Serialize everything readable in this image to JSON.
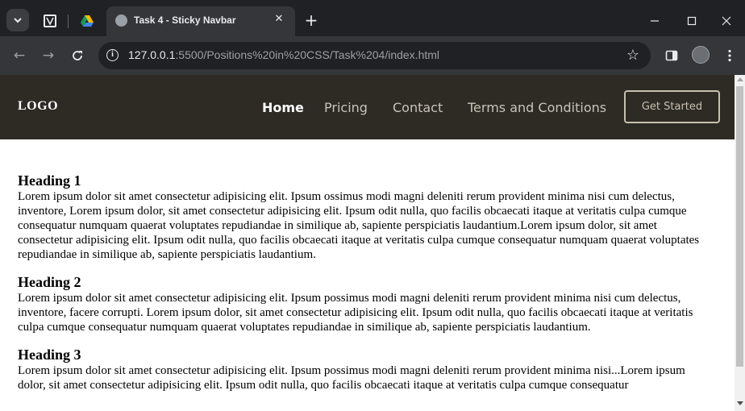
{
  "browser": {
    "tab_title": "Task 4 - Sticky Navbar",
    "url_host": "127.0.0.1",
    "url_rest": ":5500/Positions%20in%20CSS/Task%204/index.html"
  },
  "page": {
    "logo": "LOGO",
    "nav": [
      "Home",
      "Pricing",
      "Contact",
      "Terms and Conditions"
    ],
    "active_nav": "Home",
    "cta": "Get Started",
    "sections": [
      {
        "heading": "Heading 1",
        "body": "Lorem ipsum dolor sit amet consectetur adipisicing elit. Ipsum ossimus modi magni deleniti rerum provident minima nisi cum delectus, inventore, Lorem ipsum dolor, sit amet consectetur adipisicing elit. Ipsum odit nulla, quo facilis obcaecati itaque at veritatis culpa cumque consequatur numquam quaerat voluptates repudiandae in similique ab, sapiente perspiciatis laudantium.Lorem ipsum dolor, sit amet consectetur adipisicing elit. Ipsum odit nulla, quo facilis obcaecati itaque at veritatis culpa cumque consequatur numquam quaerat voluptates repudiandae in similique ab, sapiente perspiciatis laudantium."
      },
      {
        "heading": "Heading 2",
        "body": "Lorem ipsum dolor sit amet consectetur adipisicing elit. Ipsum possimus modi magni deleniti rerum provident minima nisi cum delectus, inventore, facere corrupti. Lorem ipsum dolor, sit amet consectetur adipisicing elit. Ipsum odit nulla, quo facilis obcaecati itaque at veritatis culpa cumque consequatur numquam quaerat voluptates repudiandae in similique ab, sapiente perspiciatis laudantium."
      },
      {
        "heading": "Heading 3",
        "body": "Lorem ipsum dolor sit amet consectetur adipisicing elit. Ipsum possimus modi magni deleniti rerum provident minima nisi...Lorem ipsum dolor, sit amet consectetur adipisicing elit. Ipsum odit nulla, quo facilis obcaecati itaque at veritatis culpa cumque consequatur"
      }
    ]
  },
  "colors": {
    "navbar_bg": "#2e2b25",
    "chrome_dark": "#202124",
    "chrome_toolbar": "#35363a"
  },
  "icons": {
    "tab_dropdown": "chevron-down-icon",
    "pinned_1": "pinned-site-icon",
    "pinned_2": "google-drive-icon",
    "tab_favicon": "globe-icon",
    "tab_close": "close-icon",
    "new_tab": "plus-icon",
    "back": "arrow-left-icon",
    "forward": "arrow-right-icon",
    "reload": "reload-icon",
    "site_info": "info-icon",
    "bookmark": "star-icon",
    "side_panel": "side-panel-icon",
    "profile": "avatar",
    "menu": "kebab-menu-icon"
  }
}
